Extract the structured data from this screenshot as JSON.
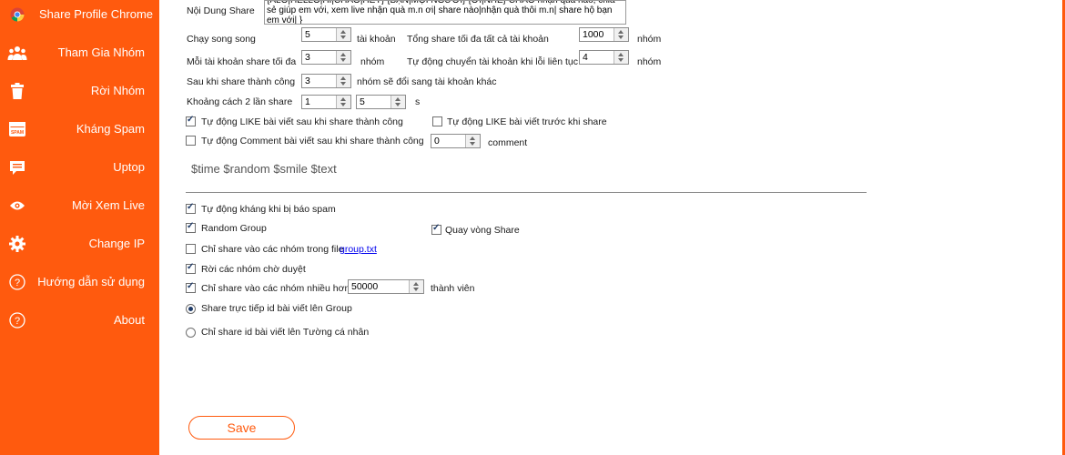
{
  "colors": {
    "accent": "#ff5a0e",
    "sidebar_text": "#ffffff",
    "link": "#0000ee"
  },
  "sidebar": {
    "items": [
      {
        "label": "Share Profile Chrome",
        "icon": "chrome-icon"
      },
      {
        "label": "Tham Gia Nhóm",
        "icon": "users-group-icon"
      },
      {
        "label": "Rời Nhóm",
        "icon": "trash-icon"
      },
      {
        "label": "Kháng Spam",
        "icon": "spam-icon"
      },
      {
        "label": "Uptop",
        "icon": "comment-icon"
      },
      {
        "label": "Mời Xem Live",
        "icon": "eye-icon"
      },
      {
        "label": "Change IP",
        "icon": "gear-icon"
      },
      {
        "label": "Hướng dẫn sử dụng",
        "icon": "help-icon"
      },
      {
        "label": "About",
        "icon": "help-icon"
      }
    ]
  },
  "form": {
    "content_label": "Nội Dung Share",
    "content_text": "{ALO|HELLO|HI|CHÀO|HEY} {BẠN|MỌI NGƯỜI} {ƠI|NHÉ} CHÀO nhận quà nào, chia sẻ giúp em với, xem live nhận quà m.n ơi| share nào|nhận quà thôi m.n| share hộ bạn em với| }",
    "parallel_label": "Chạy song song",
    "parallel_value": "5",
    "parallel_unit": "tài khoản",
    "total_share_label": "Tổng share tối đa tất cả tài khoản",
    "total_share_value": "1000",
    "total_share_unit": "nhóm",
    "per_account_label": "Mỗi tài khoản share tối đa",
    "per_account_value": "3",
    "per_account_unit": "nhóm",
    "auto_switch_label": "Tự động chuyển tài khoản khi lỗi liên tục",
    "auto_switch_value": "4",
    "auto_switch_unit": "nhóm",
    "after_success_label": "Sau khi share thành công",
    "after_success_value": "3",
    "after_success_unit": "nhóm sẽ đổi sang tài khoản khác",
    "interval_label": "Khoảng cách 2 lần share",
    "interval_min": "1",
    "interval_max": "5",
    "interval_unit": "s",
    "like_after_label": "Tự động LIKE bài viết sau khi share thành công",
    "like_after_checked": true,
    "like_before_label": "Tự động LIKE bài viết trước khi share",
    "like_before_checked": false,
    "comment_after_label": "Tự động Comment bài viết sau khi share thành công",
    "comment_after_checked": false,
    "comment_value": "0",
    "comment_unit": "comment",
    "variables_hint": "$time $random $smile $text",
    "auto_spam_label": "Tự động kháng khi bị báo spam",
    "auto_spam_checked": true,
    "random_group_label": "Random Group",
    "random_group_checked": true,
    "rotate_share_label": "Quay vòng Share",
    "rotate_share_checked": true,
    "only_file_label": "Chỉ share vào các nhóm trong file",
    "only_file_checked": false,
    "file_link": "group.txt",
    "leave_pending_label": "Rời các nhóm chờ duyệt",
    "leave_pending_checked": true,
    "min_members_label": "Chỉ share vào các nhóm nhiều hơn",
    "min_members_checked": true,
    "min_members_value": "50000",
    "min_members_unit": "thành viên",
    "radio_group_label": "Share trực tiếp id bài viết lên Group",
    "radio_group_selected": true,
    "radio_wall_label": "Chỉ share id bài viết lên Tường cá nhân",
    "radio_wall_selected": false,
    "save_label": "Save"
  }
}
